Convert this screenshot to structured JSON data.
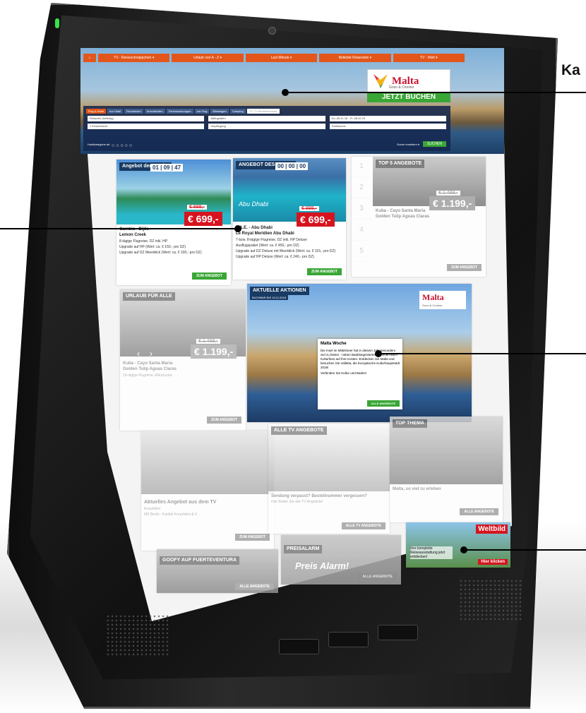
{
  "callouts": {
    "top_right_label": "Ka"
  },
  "menu": {
    "items": [
      "TV - Reiseschnäppchen ▾",
      "Urlaub von A - Z ▾",
      "Last Minute ▾",
      "Beliebte Reiseziele ▾",
      "TV - Welt ▾"
    ]
  },
  "hero": {
    "brand": "Malta",
    "brand_sub": "Gozo & Comino",
    "cta": "JETZT BUCHEN"
  },
  "search": {
    "tabs": [
      "Flug & Hotel",
      "nur Hotel",
      "Rundreisen",
      "Kreuzfahrten",
      "Ferienwohnungen",
      "nur Flug",
      "Mietwagen",
      "Camping"
    ],
    "tv_code_placeholder": "TV, TV-Bestellnummer",
    "destination": "Reiseziel (beliebig)",
    "departure": "Abflughafen",
    "dates": "Do.,08.11.18 - Fr.,08.02.19",
    "travellers": "2 Erwachsene",
    "board": "Verpflegung",
    "hotel": "Hotelsuche",
    "category_label": "Hotelkategorie ab",
    "extended": "Suche erweitern ▾",
    "submit": "SUCHEN"
  },
  "week_offer": {
    "badge": "Angebot der Woche",
    "timer": "01 | 09 | 47",
    "old_price": "€ 899,-",
    "price": "€ 699,-",
    "title": "Gambia - Bijilo",
    "hotel": "Lemon Creek",
    "desc": "8-tägige Flugreise, DZ inkl. HP",
    "bullets": [
      "Upgrade auf HP (Wert: ca. € 150,- pro DZ)",
      "Upgrade auf DZ Meerblick (Wert: ca. € 100,- pro DZ)"
    ]
  },
  "day_offer": {
    "badge": "ANGEBOT DES TAGES",
    "timer": "00 | 00 | 00",
    "place": "Abu Dhabi",
    "old_price": "€ 899,-",
    "price": "€ 699,-",
    "title": "V.A.E. - Abu Dhabi",
    "hotel": "Le Royal Meridien Abu Dhabi",
    "desc": "7-bzw. 8-tägige Flugreise, DZ inkl. HP Deluxe",
    "bullets": [
      "Ausflugspaket (Wert: ca. € 450,- pro DZ)",
      "Upgrade auf DZ Deluxe mit Meerblick (Wert: ca. € 115,- pro DZ)",
      "Upgrade auf HP Deluxe (Wert: ca. € 240,- pro DZ)"
    ],
    "button": "ZUM ANGEBOT"
  },
  "week_button": "ZUM ANGEBOT",
  "top5": {
    "badge": "TOP 5 ANGEBOTE",
    "ranks": [
      "1",
      "2",
      "3",
      "4",
      "5"
    ],
    "old_price": "€ 1.499,-",
    "price": "€ 1.199,-",
    "title": "Kuba - Cayo Santa Maria",
    "hotel": "Golden Tulip Aguas Claras",
    "button": "ZUM ANGEBOT"
  },
  "holiday_for_all": {
    "badge": "URLAUB FÜR ALLE",
    "old_price": "€ 1.499,-",
    "price": "€ 1.199,-",
    "title": "Kuba - Cayo Santa Maria",
    "hotel": "Golden Tulip Aguas Claras",
    "desc": "16-tägige Flugreise, Allinclusive",
    "button": "ZUM ANGEBOT"
  },
  "actions": {
    "badge": "AKTUELLE AKTIONEN",
    "sub": "BUCHBAR BIS 15.11.2018",
    "brand": "Malta",
    "brand_sub": "Gozo & Comino",
    "card_title": "Malta Woche",
    "card_text": "Die Insel im Mittelmeer hat in diesem Jahr besonders viel zu bieten - neben Badebegeisterten kommen auch Kulturfans auf Ihre Kosten. Entdecken Sie Malta und besuchen Sie Valletta, die Europäische Kulturhauptstadt 2018!",
    "card_cta": "Verbinden Sie Kultur und Baden!",
    "button": "ALLE ANGEBOTE"
  },
  "tv_offer": {
    "title": "Aktuelles Angebot aus dem TV",
    "sub": "Kreuzfahrt",
    "desc": "MS Berlin - Karibik Kreuzfahrt & 4 ...",
    "button": "ZUM ANGEBOT"
  },
  "all_tv": {
    "badge": "ALLE TV ANGEBOTE",
    "title": "Sendung verpasst? Bestellnummer vergessen?",
    "sub": "Hier finden Sie alle TV Angebote!",
    "button": "ALLE TV ANGEBOTE"
  },
  "top_topic": {
    "badge": "TOP THEMA",
    "title": "Malta, so viel zu erleben",
    "button": "ALLE ANGEBOTE"
  },
  "goofy": {
    "badge": "GOOFY AUF FUERTEVENTURA",
    "button": "ALLE ANGEBOTE"
  },
  "price_alarm": {
    "badge": "PREISALARM",
    "script": "Preis Alarm!",
    "button": "ALLE ANGEBOTE"
  },
  "weltbild": {
    "brand": "Weltbild",
    "text": "Ihre komplette Reiseausstattung jetzt entdecken!",
    "button": "Hier klicken"
  }
}
